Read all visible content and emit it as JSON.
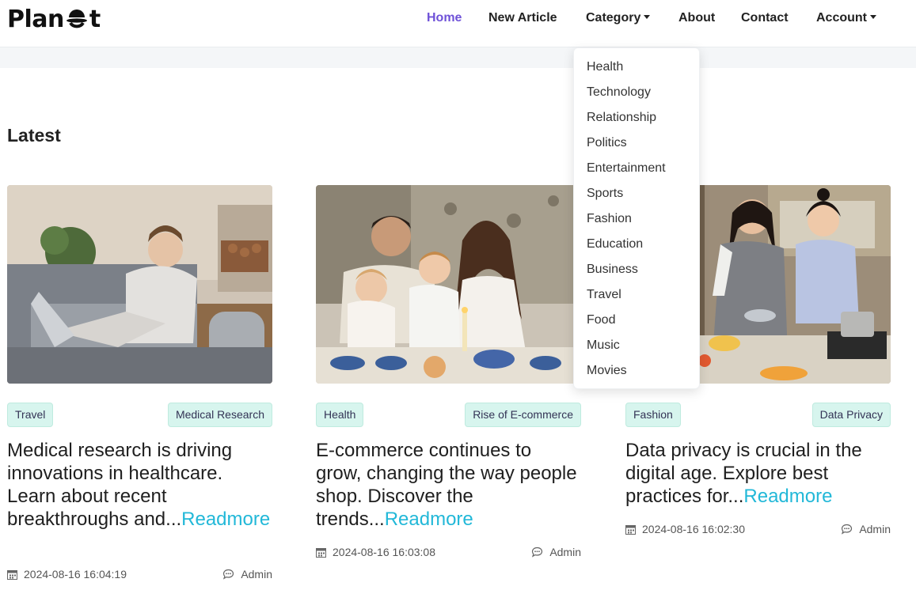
{
  "brand": {
    "name_left": "Plan",
    "name_right": "t"
  },
  "nav": {
    "home": "Home",
    "new_article": "New Article",
    "category": "Category",
    "about": "About",
    "contact": "Contact",
    "account": "Account",
    "active_color": "#6f52d8"
  },
  "category_menu": [
    "Health",
    "Technology",
    "Relationship",
    "Politics",
    "Entertainment",
    "Sports",
    "Fashion",
    "Education",
    "Business",
    "Travel",
    "Food",
    "Music",
    "Movies"
  ],
  "section": {
    "title": "Latest"
  },
  "articles": [
    {
      "tag_left": "Travel",
      "tag_right": "Medical Research",
      "excerpt": "Medical research is driving innovations in healthcare. Learn about recent breakthroughs and...",
      "readmore": "Readmore",
      "date": "2024-08-16 16:04:19",
      "author": "Admin"
    },
    {
      "tag_left": "Health",
      "tag_right": "Rise of E-commerce",
      "excerpt": "E-commerce continues to grow, changing the way people shop. Discover the trends...",
      "readmore": "Readmore",
      "date": "2024-08-16 16:03:08",
      "author": "Admin"
    },
    {
      "tag_left": "Fashion",
      "tag_right": "Data Privacy",
      "excerpt": "Data privacy is crucial in the digital age. Explore best practices for...",
      "readmore": "Readmore",
      "date": "2024-08-16 16:02:30",
      "author": "Admin"
    }
  ],
  "colors": {
    "tag_bg": "#d7f5ee",
    "readmore": "#22b8d8"
  }
}
